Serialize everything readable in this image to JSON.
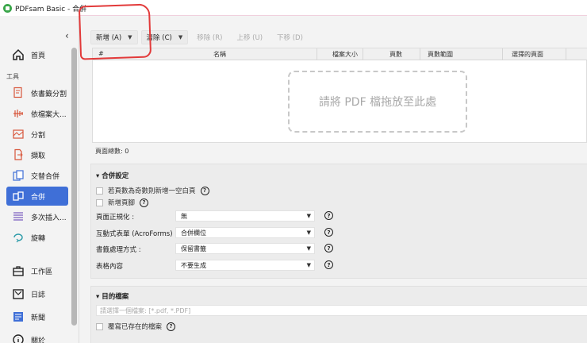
{
  "window": {
    "title": "PDFsam Basic - 合併"
  },
  "sidebar": {
    "collapse_icon": "chevron-left-icon",
    "home": {
      "label": "首頁"
    },
    "tools_label": "工具",
    "items": [
      {
        "label": "依書籤分割",
        "icon": "bookmark-split-icon"
      },
      {
        "label": "依檔案大...",
        "icon": "size-split-icon"
      },
      {
        "label": "分割",
        "icon": "split-icon"
      },
      {
        "label": "擷取",
        "icon": "extract-icon"
      },
      {
        "label": "交替合併",
        "icon": "alternate-mix-icon"
      },
      {
        "label": "合併",
        "icon": "merge-icon"
      },
      {
        "label": "多次插入...",
        "icon": "insert-icon"
      },
      {
        "label": "旋轉",
        "icon": "rotate-icon"
      }
    ],
    "bottom": [
      {
        "label": "工作區",
        "icon": "workspace-icon"
      },
      {
        "label": "日誌",
        "icon": "log-icon"
      },
      {
        "label": "新聞",
        "icon": "news-icon"
      },
      {
        "label": "關於",
        "icon": "info-icon"
      }
    ]
  },
  "toolbar": {
    "add": "新增 (A)",
    "clear": "清除 (C)",
    "remove": "移除 (R)",
    "move_up": "上移 (U)",
    "move_down": "下移 (D)"
  },
  "table": {
    "columns": [
      "#",
      "名稱",
      "檔案大小",
      "頁數",
      "頁數範圍",
      "選擇的頁面"
    ],
    "dropzone": "請將 PDF 檔拖放至此處"
  },
  "pages_total": "頁面總數: 0",
  "merge_settings": {
    "title": "合併設定",
    "blank_page": "若頁數為奇數則新增一空白頁",
    "footer": "新增頁腳",
    "normalize_label": "頁面正規化 :",
    "normalize_value": "無",
    "forms_label": "互動式表單 (AcroForms) :",
    "forms_value": "合併欄位",
    "bookmarks_label": "書籤處理方式 :",
    "bookmarks_value": "保留書籤",
    "toc_label": "表格內容",
    "toc_value": "不要生成"
  },
  "destination": {
    "title": "目的檔案",
    "placeholder": "請選擇一個檔案: [*.pdf, *.PDF]",
    "overwrite": "覆寫已存在的檔案"
  },
  "colors": {
    "active": "#3f6fd7",
    "annotation": "#e23a3a"
  }
}
